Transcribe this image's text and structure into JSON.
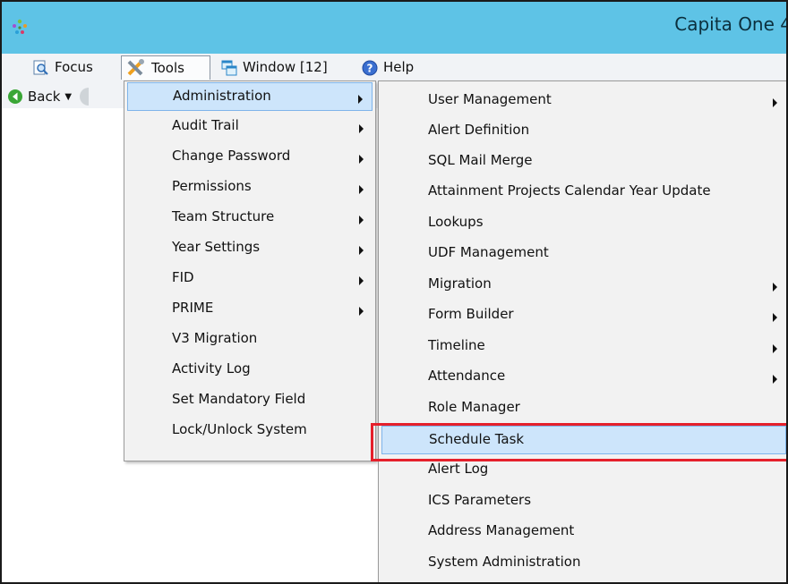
{
  "window": {
    "title": "Capita One 4"
  },
  "menubar": {
    "items": [
      {
        "label": "Focus",
        "icon": "magnifier-icon"
      },
      {
        "label": "Tools",
        "icon": "tools-icon"
      },
      {
        "label": "Window [12]",
        "icon": "windows-icon"
      },
      {
        "label": "Help",
        "icon": "help-icon"
      }
    ]
  },
  "navbar": {
    "back_label": "Back"
  },
  "tools_menu": {
    "items": [
      {
        "label": "Administration",
        "submenu": true
      },
      {
        "label": "Audit Trail",
        "submenu": true
      },
      {
        "label": "Change Password",
        "submenu": true
      },
      {
        "label": "Permissions",
        "submenu": true
      },
      {
        "label": "Team Structure",
        "submenu": true
      },
      {
        "label": "Year Settings",
        "submenu": true
      },
      {
        "label": "FID",
        "submenu": true
      },
      {
        "label": "PRIME",
        "submenu": true
      },
      {
        "label": "V3 Migration",
        "submenu": false
      },
      {
        "label": "Activity Log",
        "submenu": false
      },
      {
        "label": "Set Mandatory Field",
        "submenu": false
      },
      {
        "label": "Lock/Unlock System",
        "submenu": false
      }
    ]
  },
  "admin_menu": {
    "items": [
      {
        "label": "User Management",
        "submenu": true
      },
      {
        "label": "Alert Definition",
        "submenu": false
      },
      {
        "label": "SQL Mail Merge",
        "submenu": false
      },
      {
        "label": "Attainment Projects Calendar Year Update",
        "submenu": false
      },
      {
        "label": "Lookups",
        "submenu": false
      },
      {
        "label": "UDF Management",
        "submenu": false
      },
      {
        "label": "Migration",
        "submenu": true
      },
      {
        "label": "Form Builder",
        "submenu": true
      },
      {
        "label": "Timeline",
        "submenu": true
      },
      {
        "label": "Attendance",
        "submenu": true
      },
      {
        "label": "Role Manager",
        "submenu": false
      },
      {
        "label": "Schedule Task",
        "submenu": false
      },
      {
        "label": "Alert Log",
        "submenu": false
      },
      {
        "label": "ICS Parameters",
        "submenu": false
      },
      {
        "label": "Address Management",
        "submenu": false
      },
      {
        "label": "System Administration",
        "submenu": false
      }
    ]
  },
  "colors": {
    "titlebar": "#5ec3e6",
    "hover_highlight": "#cde5fb",
    "callout_box": "#e5202b"
  }
}
